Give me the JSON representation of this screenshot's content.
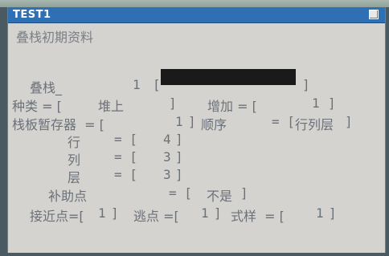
{
  "window": {
    "title": "TEST1",
    "subtitle": "叠栈初期资料"
  },
  "fields": {
    "stack_label": "叠栈_",
    "stack_number": "1",
    "stack_bracket_open": "[",
    "stack_bracket_close": "]",
    "type_label": "种类 = [",
    "type_value": "堆上",
    "type_close": "]",
    "increase_label": "增加 = [",
    "increase_value": "1",
    "increase_close": "]",
    "buffer_label": "栈板暂存器  = [",
    "buffer_value": "1",
    "buffer_close": "]",
    "order_label": "顺序",
    "order_eq": "= [",
    "order_value": "行列层",
    "order_close": "]",
    "row_label": "行",
    "row_eq": "= [",
    "row_value": "4",
    "row_close": "]",
    "col_label": "列",
    "col_eq": "= [",
    "col_value": "3",
    "col_close": "]",
    "layer_label": "层",
    "layer_eq": "= [",
    "layer_value": "3",
    "layer_close": "]",
    "aux_label": "补助点",
    "aux_eq": "= [",
    "aux_value": "不是",
    "aux_close": "]",
    "approach_label": "接近点=[",
    "approach_value": "1",
    "approach_close": "]",
    "escape_label": "逃点 =[",
    "escape_value": "1",
    "escape_close": "]",
    "style_label": "式样  = [",
    "style_value": "1",
    "style_close": "]"
  }
}
